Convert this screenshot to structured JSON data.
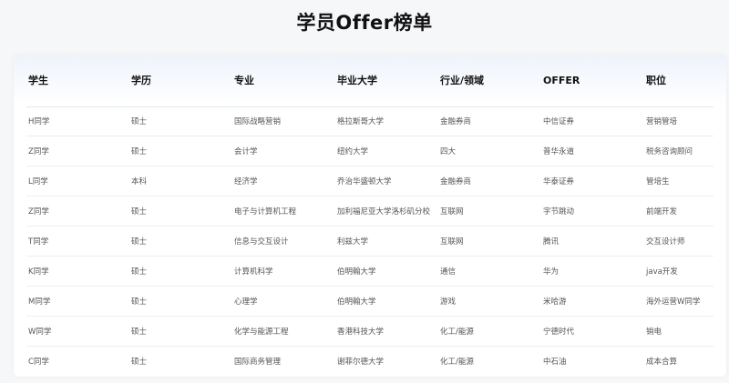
{
  "title": "学员Offer榜单",
  "columns": [
    "学生",
    "学历",
    "专业",
    "毕业大学",
    "行业/领域",
    "OFFER",
    "职位"
  ],
  "rows": [
    [
      "H同学",
      "硕士",
      "国际战略营销",
      "格拉斯哥大学",
      "金融券商",
      "中信证券",
      "营销管培"
    ],
    [
      "Z同学",
      "硕士",
      "会计学",
      "纽约大学",
      "四大",
      "普华永道",
      "税务咨询顾问"
    ],
    [
      "L同学",
      "本科",
      "经济学",
      "乔治华盛顿大学",
      "金融券商",
      "华泰证券",
      "管培生"
    ],
    [
      "Z同学",
      "硕士",
      "电子与计算机工程",
      "加利福尼亚大学洛杉矶分校",
      "互联网",
      "字节跳动",
      "前端开发"
    ],
    [
      "T同学",
      "硕士",
      "信息与交互设计",
      "利兹大学",
      "互联网",
      "腾讯",
      "交互设计师"
    ],
    [
      "K同学",
      "硕士",
      "计算机科学",
      "伯明翰大学",
      "通信",
      "华为",
      "java开发"
    ],
    [
      "M同学",
      "硕士",
      "心理学",
      "伯明翰大学",
      "游戏",
      "米哈游",
      "海外运营W同学"
    ],
    [
      "W同学",
      "硕士",
      "化学与能源工程",
      "香港科技大学",
      "化工/能源",
      "宁德时代",
      "销电"
    ],
    [
      "C同学",
      "硕士",
      "国际商务管理",
      "谢菲尔德大学",
      "化工/能源",
      "中石油",
      "成本合算"
    ]
  ]
}
